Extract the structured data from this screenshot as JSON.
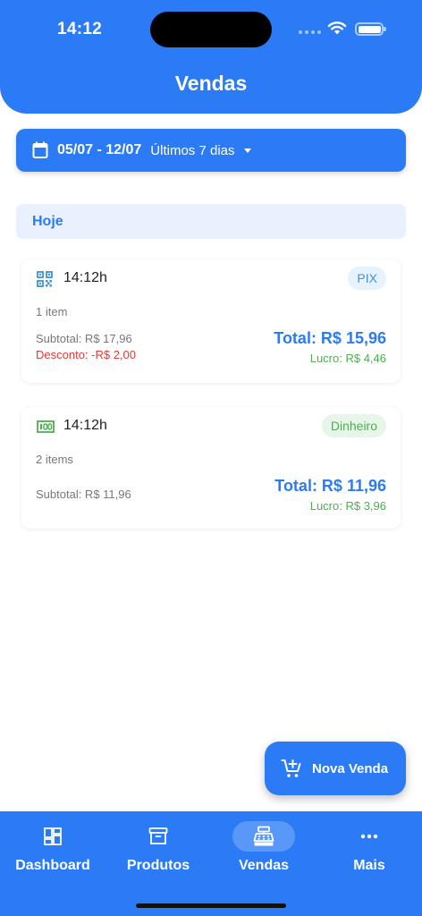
{
  "status_bar": {
    "time": "14:12"
  },
  "header": {
    "title": "Vendas"
  },
  "date_filter": {
    "range": "05/07 - 12/07",
    "preset": "Últimos 7 dias"
  },
  "section": {
    "label": "Hoje"
  },
  "sales": [
    {
      "payment_icon": "qr-code-icon",
      "time": "14:12h",
      "method": "PIX",
      "items": "1 item",
      "subtotal": "Subtotal: R$ 17,96",
      "discount": "Desconto: -R$ 2,00",
      "total": "Total: R$ 15,96",
      "profit": "Lucro: R$ 4,46"
    },
    {
      "payment_icon": "cash-icon",
      "time": "14:12h",
      "method": "Dinheiro",
      "items": "2 items",
      "subtotal": "Subtotal: R$ 11,96",
      "total": "Total: R$ 11,96",
      "profit": "Lucro: R$ 3,96"
    }
  ],
  "fab": {
    "label": "Nova Venda"
  },
  "nav": {
    "items": [
      {
        "label": "Dashboard",
        "icon": "dashboard-icon"
      },
      {
        "label": "Produtos",
        "icon": "archive-box-icon"
      },
      {
        "label": "Vendas",
        "icon": "cash-register-icon",
        "active": true
      },
      {
        "label": "Mais",
        "icon": "more-dots-icon"
      }
    ]
  },
  "colors": {
    "primary": "#2b7bf7",
    "profit": "#4caf50",
    "discount": "#e53935",
    "section_bg": "#e9f1ff"
  }
}
